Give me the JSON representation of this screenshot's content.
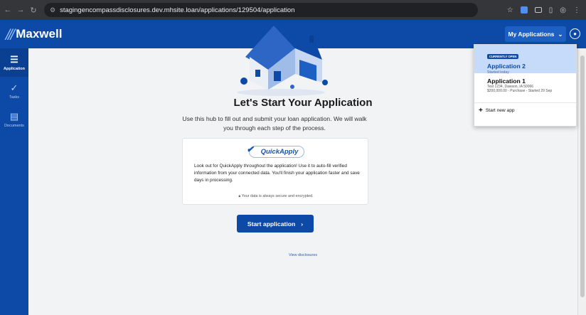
{
  "browser": {
    "url": "stagingencompassdisclosures.dev.mhsite.loan/applications/129504/application"
  },
  "header": {
    "brand": "Maxwell",
    "my_applications_label": "My Applications"
  },
  "sidebar": {
    "items": [
      {
        "label": "Application",
        "icon": "list-icon",
        "active": true
      },
      {
        "label": "Tasks",
        "icon": "check-icon",
        "active": false
      },
      {
        "label": "Documents",
        "icon": "document-icon",
        "active": false
      }
    ]
  },
  "main": {
    "title": "Let's Start Your Application",
    "subtitle": "Use this hub to fill out and submit your loan application. We will walk you through each step of the process.",
    "quickapply": {
      "badge": "QuickApply",
      "text": "Look out for QuickApply throughout the application! Use it to auto-fill verified information from your connected data. You'll finish your application faster and save days in processing.",
      "secure_text": "Your data is always secure and encrypted."
    },
    "start_button": "Start application",
    "disclosures_link": "View disclosures"
  },
  "dropdown": {
    "current": {
      "badge": "CURRENTLY OPEN",
      "title": "Application 2",
      "subtitle": "Started today"
    },
    "other": {
      "title": "Application 1",
      "line1": "Test 1234, Dawson, IA 50066",
      "line2": "$200,000.00 - Purchase - Started 29 Sep"
    },
    "new_label": "Start new app"
  },
  "colors": {
    "brand": "#0d4aa8",
    "highlight": "#c6dbfa"
  }
}
